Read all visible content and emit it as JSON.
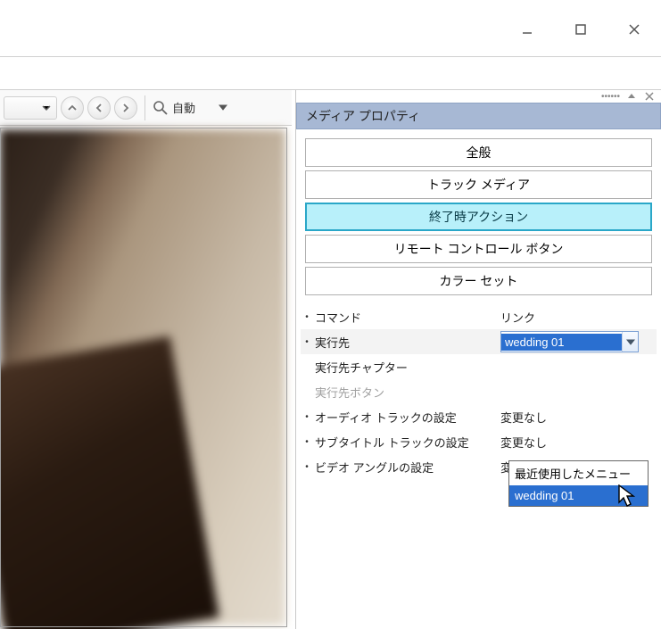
{
  "window_controls": {
    "minimize": "minimize",
    "maximize": "maximize",
    "close": "close"
  },
  "preview_toolbar": {
    "zoom_label": "自動"
  },
  "panel": {
    "title": "メディア プロパティ",
    "tabs": {
      "general": "全般",
      "track_media": "トラック メディア",
      "end_action": "終了時アクション",
      "remote_buttons": "リモート コントロール ボタン",
      "color_set": "カラー セット"
    },
    "active_tab": "end_action",
    "rows": {
      "command": {
        "label": "コマンド",
        "value": "リンク"
      },
      "dest": {
        "label": "実行先",
        "selected": "wedding 01",
        "options": [
          "最近使用したメニュー",
          "wedding 01"
        ],
        "hover_index": 1
      },
      "dest_chapter": {
        "label": "実行先チャプター",
        "value": ""
      },
      "dest_button": {
        "label": "実行先ボタン",
        "value": ""
      },
      "audio_track": {
        "label": "オーディオ トラックの設定",
        "value": "変更なし"
      },
      "subtitle_track": {
        "label": "サブタイトル トラックの設定",
        "value": "変更なし"
      },
      "video_angle": {
        "label": "ビデオ アングルの設定",
        "value": "変更なし"
      }
    }
  }
}
